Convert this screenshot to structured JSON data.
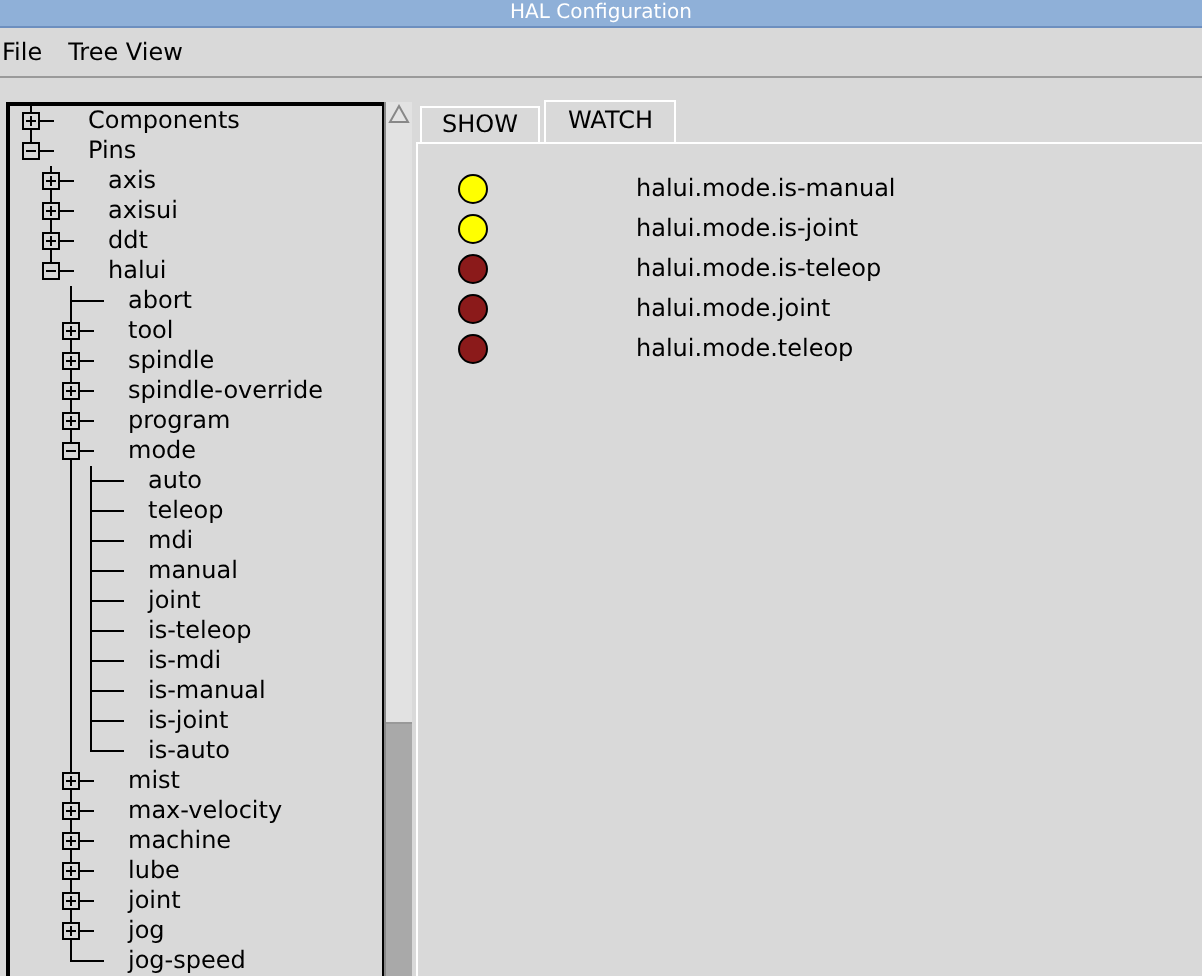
{
  "window": {
    "title": "HAL Configuration"
  },
  "menu": [
    "File",
    "Tree View"
  ],
  "tree": [
    {
      "label": "Components",
      "kind": "branch",
      "expanded": false
    },
    {
      "label": "Pins",
      "kind": "branch",
      "expanded": true,
      "children": [
        {
          "label": "axis",
          "kind": "branch",
          "expanded": false
        },
        {
          "label": "axisui",
          "kind": "branch",
          "expanded": false
        },
        {
          "label": "ddt",
          "kind": "branch",
          "expanded": false
        },
        {
          "label": "halui",
          "kind": "branch",
          "expanded": true,
          "children": [
            {
              "label": "abort",
              "kind": "leaf"
            },
            {
              "label": "tool",
              "kind": "branch",
              "expanded": false
            },
            {
              "label": "spindle",
              "kind": "branch",
              "expanded": false
            },
            {
              "label": "spindle-override",
              "kind": "branch",
              "expanded": false
            },
            {
              "label": "program",
              "kind": "branch",
              "expanded": false
            },
            {
              "label": "mode",
              "kind": "branch",
              "expanded": true,
              "children": [
                {
                  "label": "auto",
                  "kind": "leaf"
                },
                {
                  "label": "teleop",
                  "kind": "leaf"
                },
                {
                  "label": "mdi",
                  "kind": "leaf"
                },
                {
                  "label": "manual",
                  "kind": "leaf"
                },
                {
                  "label": "joint",
                  "kind": "leaf"
                },
                {
                  "label": "is-teleop",
                  "kind": "leaf"
                },
                {
                  "label": "is-mdi",
                  "kind": "leaf"
                },
                {
                  "label": "is-manual",
                  "kind": "leaf"
                },
                {
                  "label": "is-joint",
                  "kind": "leaf"
                },
                {
                  "label": "is-auto",
                  "kind": "leaf"
                }
              ]
            },
            {
              "label": "mist",
              "kind": "branch",
              "expanded": false
            },
            {
              "label": "max-velocity",
              "kind": "branch",
              "expanded": false
            },
            {
              "label": "machine",
              "kind": "branch",
              "expanded": false
            },
            {
              "label": "lube",
              "kind": "branch",
              "expanded": false
            },
            {
              "label": "joint",
              "kind": "branch",
              "expanded": false
            },
            {
              "label": "jog",
              "kind": "branch",
              "expanded": false
            },
            {
              "label": "jog-speed",
              "kind": "leaf"
            }
          ]
        }
      ]
    }
  ],
  "tabs": [
    {
      "label": "SHOW",
      "selected": false
    },
    {
      "label": "WATCH",
      "selected": true
    }
  ],
  "watch": [
    {
      "name": "halui.mode.is-manual",
      "on": true
    },
    {
      "name": "halui.mode.is-joint",
      "on": true
    },
    {
      "name": "halui.mode.is-teleop",
      "on": false
    },
    {
      "name": "halui.mode.joint",
      "on": false
    },
    {
      "name": "halui.mode.teleop",
      "on": false
    }
  ]
}
